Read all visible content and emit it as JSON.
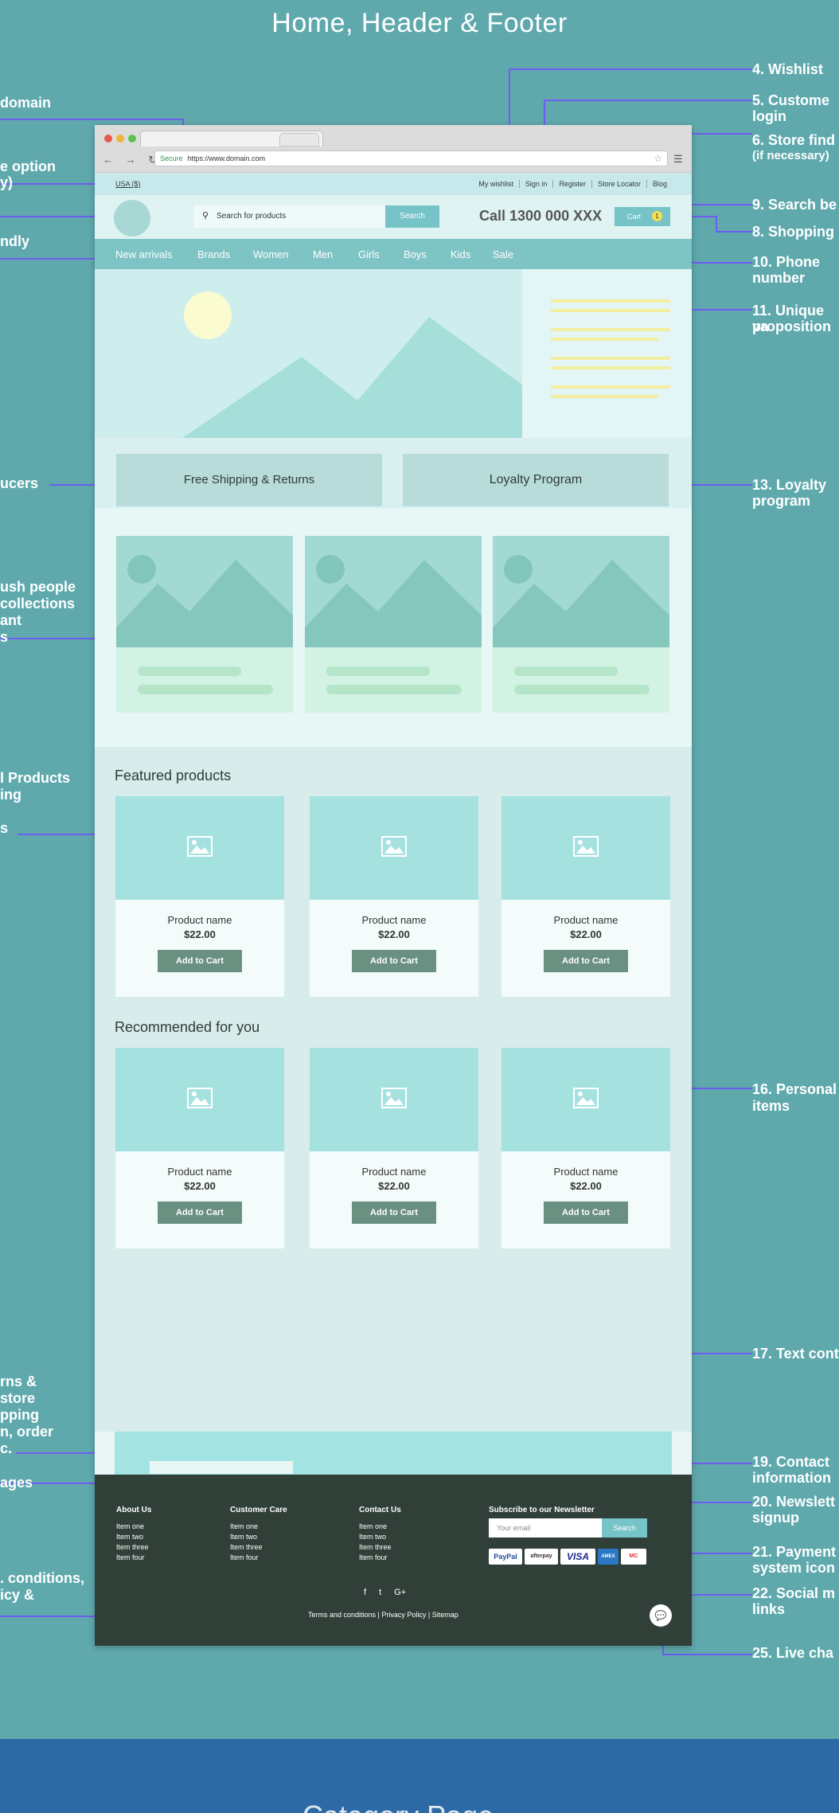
{
  "page_title": "Home, Header & Footer",
  "next_section_title": "Category Page",
  "browser": {
    "secure_label": "Secure",
    "url": "https://www.domain.com",
    "tab_close": "×"
  },
  "topbar": {
    "country": "USA ($)",
    "links": [
      "My wishlist",
      "Sign in",
      "Register",
      "Store Locator",
      "Blog"
    ]
  },
  "header": {
    "search_placeholder": "Search for products",
    "search_button": "Search",
    "phone": "Call 1300 000 XXX",
    "cart_label": "Cart",
    "cart_count": "1"
  },
  "nav": [
    "New arrivals",
    "Brands",
    "Women",
    "Men",
    "Girls",
    "Boys",
    "Kids",
    "Sale"
  ],
  "usp": {
    "left": "Free Shipping & Returns",
    "right": "Loyalty Program"
  },
  "featured": {
    "title": "Featured products",
    "products": [
      {
        "name": "Product name",
        "price": "$22.00",
        "button": "Add to Cart"
      },
      {
        "name": "Product name",
        "price": "$22.00",
        "button": "Add to Cart"
      },
      {
        "name": "Product name",
        "price": "$22.00",
        "button": "Add to Cart"
      }
    ]
  },
  "recommended": {
    "title": "Recommended for you",
    "products": [
      {
        "name": "Product name",
        "price": "$22.00",
        "button": "Add to Cart"
      },
      {
        "name": "Product name",
        "price": "$22.00",
        "button": "Add to Cart"
      },
      {
        "name": "Product name",
        "price": "$22.00",
        "button": "Add to Cart"
      }
    ]
  },
  "footer": {
    "columns": [
      {
        "heading": "About Us",
        "items": [
          "Item one",
          "Item two",
          "Item three",
          "Item four"
        ]
      },
      {
        "heading": "Customer Care",
        "items": [
          "Item one",
          "Item two",
          "Item three",
          "Item four"
        ]
      },
      {
        "heading": "Contact Us",
        "items": [
          "Item one",
          "Item two",
          "Item three",
          "Item four"
        ]
      }
    ],
    "newsletter_heading": "Subscribe to our Newsletter",
    "newsletter_placeholder": "Your email",
    "newsletter_button": "Search",
    "payments": [
      "PayPal",
      "afterpay",
      "VISA",
      "AMEX",
      "MC"
    ],
    "social": [
      "f",
      "t",
      "G+"
    ],
    "legal": "Terms and conditions | Privacy Policy | Sitemap"
  },
  "annotations": {
    "left": [
      "domain",
      "e option",
      "y)",
      "ndly",
      "ucers",
      "ush people",
      "collections",
      "ant",
      "s",
      "l Products",
      "ing",
      "s",
      "rns &",
      "store",
      "pping",
      "n, order",
      "c.",
      "ages",
      ". conditions,",
      "icy &"
    ],
    "right": [
      "4. Wishlist",
      "5. Custome",
      "login",
      "6. Store find",
      "(if necessary)",
      "9. Search be",
      "8. Shopping",
      "10. Phone",
      "number",
      "11. Unique va",
      "proposition",
      "13. Loyalty",
      "program",
      "16. Personal",
      "items",
      "17. Text cont",
      "19. Contact",
      "information",
      "20. Newslett",
      "signup",
      "21. Payment",
      "system icon",
      "22. Social m",
      "links",
      "25. Live cha"
    ]
  },
  "colors": {
    "background": "#5fa9ad",
    "accent": "#76c3c8",
    "annotation_line": "#6d5ef0",
    "footer": "#304038",
    "next_section_band": "#2d6aa5"
  }
}
